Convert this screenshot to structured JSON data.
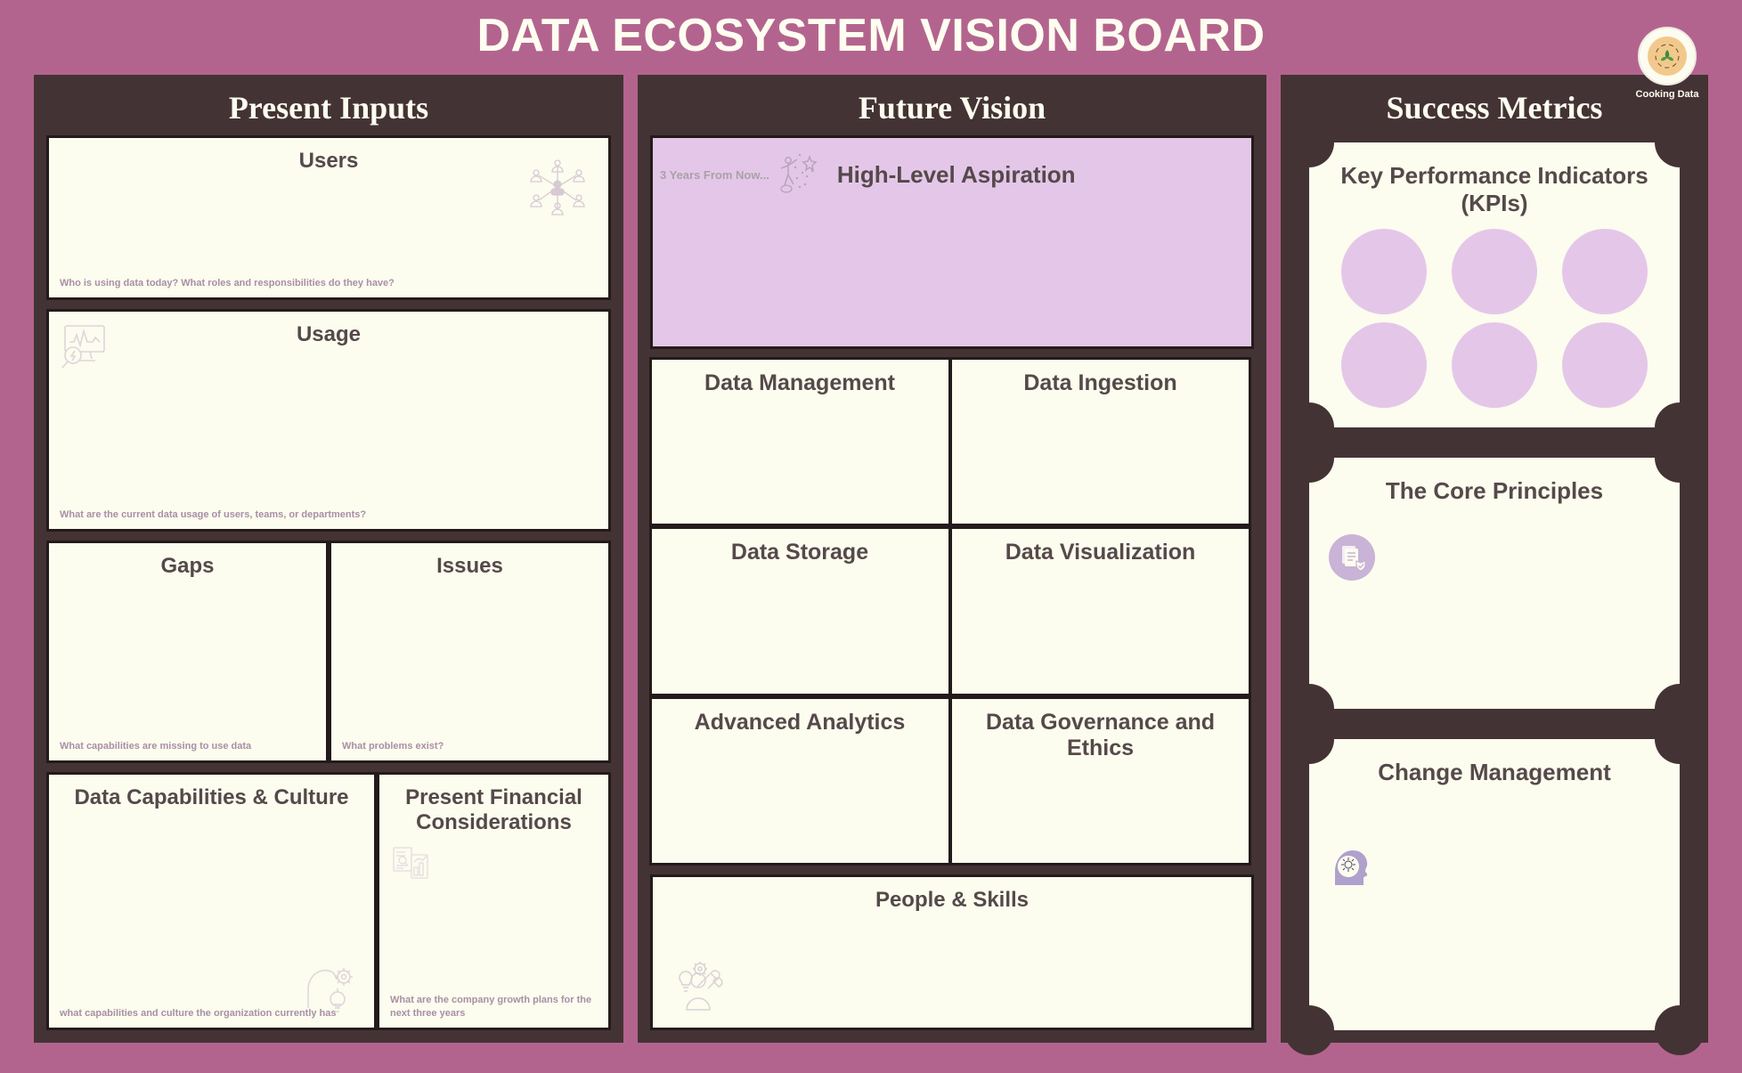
{
  "board": {
    "title": "DATA ECOSYSTEM VISION BOARD",
    "background_color": "#b3648e",
    "panel_color": "#443334",
    "card_color": "#fcfcef",
    "accent_color": "#e4c7e8"
  },
  "logo": {
    "label": "Cooking Data",
    "icon": "plate-herb-icon"
  },
  "columns": [
    {
      "id": "present-inputs",
      "heading": "Present Inputs",
      "cards": [
        {
          "title": "Users",
          "hint": "Who is using data today? What roles and responsibilities do they have?",
          "icon": "user-network-icon"
        },
        {
          "title": "Usage",
          "hint": "What are the current data usage of users, teams, or departments?",
          "icon": "monitor-analytics-icon"
        },
        {
          "title": "Gaps",
          "hint": "What capabilities are missing to use data",
          "icon": ""
        },
        {
          "title": "Issues",
          "hint": "What problems exist?",
          "icon": ""
        },
        {
          "title": "Data Capabilities & Culture",
          "hint": "what capabilities and culture the organization currently has",
          "icon": "head-idea-gear-icon"
        },
        {
          "title": "Present Financial Considerations",
          "hint": "What are the company growth plans for the next three years",
          "icon": "financial-report-icon"
        }
      ]
    },
    {
      "id": "future-vision",
      "heading": "Future Vision",
      "aspiration": {
        "eyebrow": "3 Years From Now...",
        "title": "High-Level Aspiration",
        "icon": "person-star-dream-icon"
      },
      "grid": [
        {
          "title": "Data Management"
        },
        {
          "title": "Data Ingestion"
        },
        {
          "title": "Data Storage"
        },
        {
          "title": "Data Visualization"
        },
        {
          "title": "Advanced Analytics"
        },
        {
          "title": "Data Governance and Ethics"
        }
      ],
      "full_card": {
        "title": "People & Skills",
        "icon": "person-skills-tools-icon"
      }
    },
    {
      "id": "success-metrics",
      "heading": "Success Metrics",
      "tickets": [
        {
          "title": "Key Performance Indicators (KPIs)",
          "dot_count": 6,
          "icon": ""
        },
        {
          "title": "The Core Principles",
          "icon": "document-check-icon"
        },
        {
          "title": "Change Management",
          "icon": "head-gear-icon"
        }
      ]
    }
  ]
}
